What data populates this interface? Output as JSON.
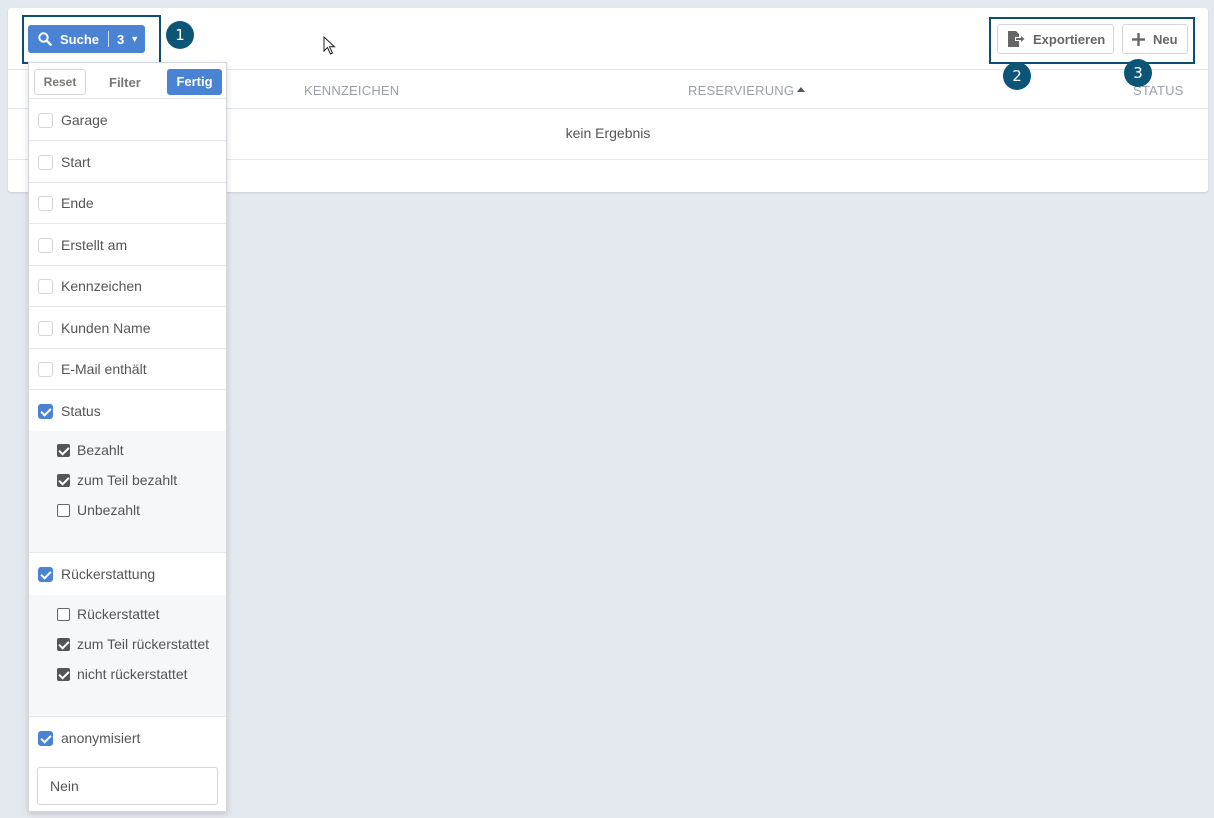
{
  "toolbar": {
    "search_label": "Suche",
    "search_count": "3",
    "export_label": "Exportieren",
    "new_label": "Neu"
  },
  "table": {
    "columns": [
      "KENNZEICHEN",
      "RESERVIERUNG",
      "STATUS"
    ],
    "empty_text": "kein Ergebnis"
  },
  "filter_panel": {
    "reset_label": "Reset",
    "filter_label": "Filter",
    "done_label": "Fertig",
    "items": [
      {
        "label": "Garage",
        "checked": false
      },
      {
        "label": "Start",
        "checked": false
      },
      {
        "label": "Ende",
        "checked": false
      },
      {
        "label": "Erstellt am",
        "checked": false
      },
      {
        "label": "Kennzeichen",
        "checked": false
      },
      {
        "label": "Kunden Name",
        "checked": false
      },
      {
        "label": "E-Mail enthält",
        "checked": false
      },
      {
        "label": "Status",
        "checked": true
      },
      {
        "label": "Rückerstattung",
        "checked": true
      },
      {
        "label": "anonymisiert",
        "checked": true
      }
    ],
    "status_options": [
      {
        "label": "Bezahlt",
        "checked": true
      },
      {
        "label": "zum Teil bezahlt",
        "checked": true
      },
      {
        "label": "Unbezahlt",
        "checked": false
      }
    ],
    "refund_options": [
      {
        "label": "Rückerstattet",
        "checked": false
      },
      {
        "label": "zum Teil rückerstattet",
        "checked": true
      },
      {
        "label": "nicht rückerstattet",
        "checked": true
      }
    ],
    "anonymized_value": "Nein"
  },
  "annotations": {
    "badge_1": "1",
    "badge_2": "2",
    "badge_3": "3"
  },
  "colors": {
    "primary": "#4a82d4",
    "annotation": "#0d5577",
    "background": "#e4e8ef"
  }
}
